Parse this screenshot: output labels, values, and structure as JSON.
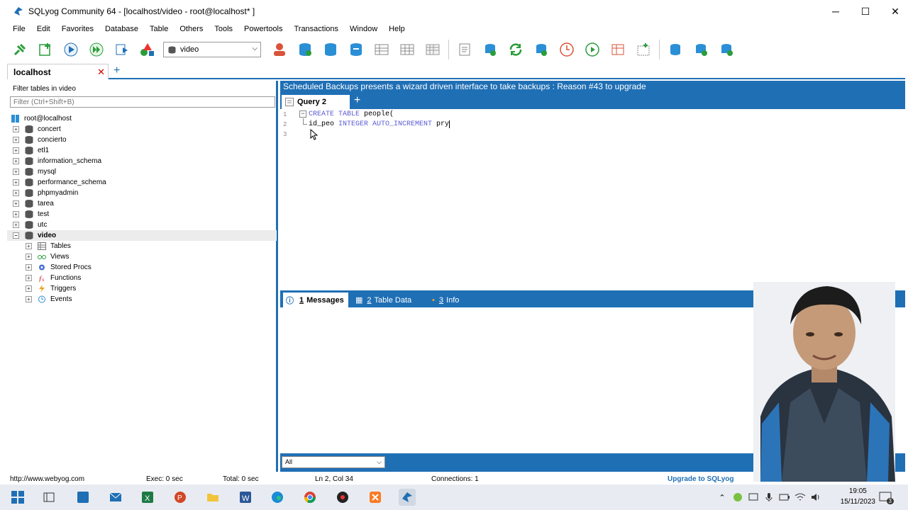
{
  "window": {
    "title": "SQLyog Community 64 - [localhost/video - root@localhost* ]",
    "minimize": "─",
    "maximize": "☐",
    "close": "✕"
  },
  "menu": [
    "File",
    "Edit",
    "Favorites",
    "Database",
    "Table",
    "Others",
    "Tools",
    "Powertools",
    "Transactions",
    "Window",
    "Help"
  ],
  "toolbar": {
    "database_select": "video"
  },
  "connection_tab": {
    "label": "localhost",
    "close": "✕",
    "add": "+"
  },
  "object_browser": {
    "filter_label": "Filter tables in video",
    "filter_placeholder": "Filter (Ctrl+Shift+B)",
    "root": "root@localhost",
    "databases": [
      "concert",
      "concierto",
      "etl1",
      "information_schema",
      "mysql",
      "performance_schema",
      "phpmyadmin",
      "tarea",
      "test",
      "utc",
      "video"
    ],
    "selected_database": "video",
    "children": [
      "Tables",
      "Views",
      "Stored Procs",
      "Functions",
      "Triggers",
      "Events"
    ]
  },
  "banner": "Scheduled Backups presents a wizard driven interface to take backups : Reason #43 to upgrade",
  "query_tab": {
    "label": "Query 2",
    "add": "+"
  },
  "editor": {
    "line_numbers": [
      "1",
      "2",
      "3"
    ],
    "lines": [
      {
        "kw1": "CREATE TABLE",
        "rest": " people("
      },
      {
        "ident": "id_peo",
        "kw1": " INTEGER AUTO_INCREMENT",
        "rest": " pry"
      },
      {
        "rest": ""
      }
    ]
  },
  "result_tabs": [
    {
      "num": "1",
      "label": "Messages"
    },
    {
      "num": "2",
      "label": "Table Data"
    },
    {
      "num": "3",
      "label": "Info"
    }
  ],
  "result_filter": "All",
  "statusbar": {
    "url": "http://www.webyog.com",
    "exec": "Exec: 0 sec",
    "total": "Total: 0 sec",
    "position": "Ln 2, Col 34",
    "connections": "Connections: 1",
    "upgrade": "Upgrade to SQLyog"
  },
  "taskbar": {
    "time": "19:05",
    "date": "15/11/2023",
    "notification_count": "3"
  },
  "colors": {
    "accent": "#1f6fb5",
    "keyword": "#5b5bd6"
  }
}
